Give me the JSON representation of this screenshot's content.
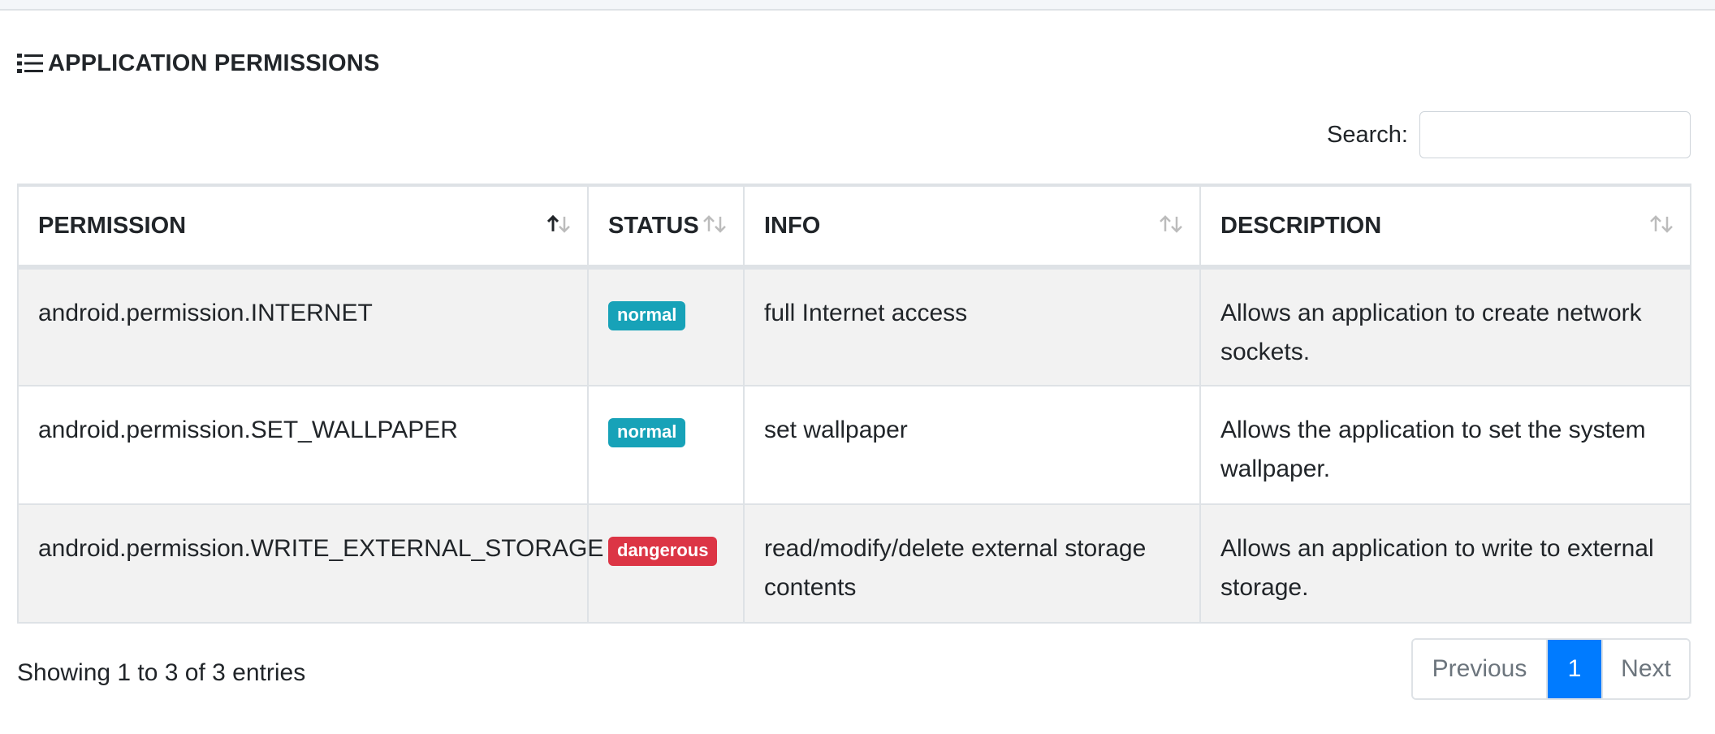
{
  "card": {
    "title": "APPLICATION PERMISSIONS",
    "title_icon": "list-icon"
  },
  "search": {
    "label": "Search:",
    "value": "",
    "placeholder": ""
  },
  "table": {
    "columns": [
      {
        "label": "PERMISSION",
        "sort": "ascending"
      },
      {
        "label": "STATUS",
        "sort": "none"
      },
      {
        "label": "INFO",
        "sort": "none"
      },
      {
        "label": "DESCRIPTION",
        "sort": "none"
      }
    ],
    "rows": [
      {
        "permission": "android.permission.INTERNET",
        "status": "normal",
        "info": "full Internet access",
        "description": "Allows an application to create network sockets."
      },
      {
        "permission": "android.permission.SET_WALLPAPER",
        "status": "normal",
        "info": "set wallpaper",
        "description": "Allows the application to set the system wallpaper."
      },
      {
        "permission": "android.permission.WRITE_EXTERNAL_STORAGE",
        "status": "dangerous",
        "info": "read/modify/delete external storage contents",
        "description": "Allows an application to write to external storage."
      }
    ]
  },
  "footer": {
    "info": "Showing 1 to 3 of 3 entries"
  },
  "pagination": {
    "previous": "Previous",
    "current": "1",
    "next": "Next"
  },
  "colors": {
    "badge_normal": "#17a2b8",
    "badge_dangerous": "#dc3545",
    "active_page": "#007bff",
    "striped_row": "#f2f2f2"
  }
}
